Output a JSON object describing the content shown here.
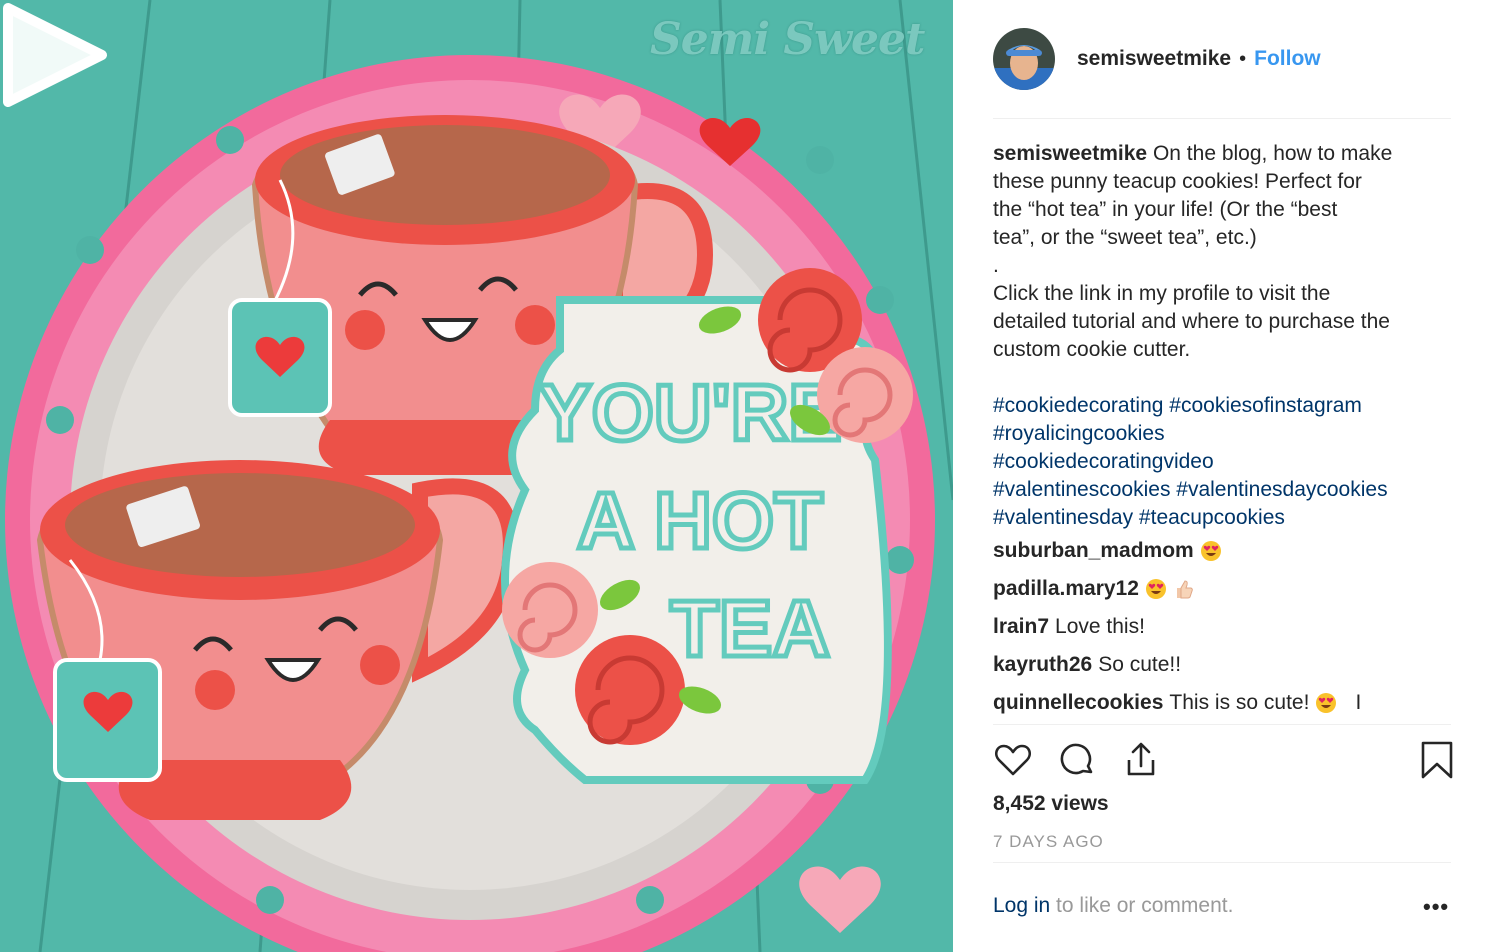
{
  "media": {
    "watermark": "Semi Sweet",
    "cookie_text": [
      "YOU'RE",
      "A HOT",
      "TEA"
    ]
  },
  "header": {
    "username": "semisweetmike",
    "separator": "•",
    "follow_label": "Follow"
  },
  "caption": {
    "username": "semisweetmike",
    "lines": [
      "On the blog, how to make",
      "these punny teacup cookies! Perfect for",
      "the “hot tea” in your life! (Or the “best",
      "tea”, or the “sweet tea”, etc.)",
      ".",
      "Click the link in my profile to visit the",
      "detailed tutorial and where to purchase the",
      "custom cookie cutter."
    ],
    "hashtag_lines": [
      "#cookiedecorating #cookiesofinstagram",
      "#royalicingcookies",
      "#cookiedecoratingvideo",
      "#valentinescookies #valentinesdaycookies",
      "#valentinesday #teacupcookies"
    ]
  },
  "comments": [
    {
      "user": "suburban_madmom",
      "text": "",
      "emojis": [
        "heart-eyes-emoji"
      ]
    },
    {
      "user": "padilla.mary12",
      "text": "",
      "emojis": [
        "heart-eyes-emoji",
        "thumbs-up-emoji"
      ]
    },
    {
      "user": "lrain7",
      "text": "Love this!",
      "emojis": []
    },
    {
      "user": "kayruth26",
      "text": "So cute!!",
      "emojis": []
    },
    {
      "user": "quinnellecookies",
      "text": "This is so cute!",
      "emojis": [
        "heart-eyes-emoji"
      ],
      "trailing": "I"
    }
  ],
  "actions": [
    "heart-icon",
    "comment-icon",
    "share-icon",
    "bookmark-icon"
  ],
  "stats": {
    "views": "8,452 views",
    "time": "7 DAYS AGO"
  },
  "footer": {
    "login_link": "Log in",
    "login_rest": " to like or comment.",
    "more": "•••"
  },
  "colors": {
    "link_blue": "#3897f0",
    "hashtag_blue": "#003569",
    "muted": "#999999",
    "teal_background": "#4fb3a5",
    "cup_pink": "#f28e8e",
    "icing_red": "#ec5148"
  }
}
